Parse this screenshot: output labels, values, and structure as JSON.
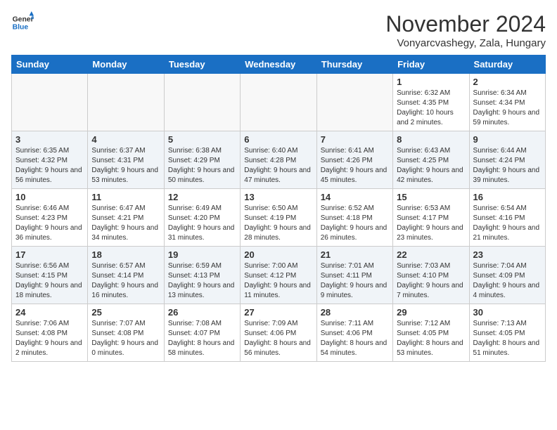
{
  "logo": {
    "line1": "General",
    "line2": "Blue"
  },
  "title": "November 2024",
  "subtitle": "Vonyarcvashegy, Zala, Hungary",
  "days_of_week": [
    "Sunday",
    "Monday",
    "Tuesday",
    "Wednesday",
    "Thursday",
    "Friday",
    "Saturday"
  ],
  "weeks": [
    [
      {
        "day": "",
        "empty": true
      },
      {
        "day": "",
        "empty": true
      },
      {
        "day": "",
        "empty": true
      },
      {
        "day": "",
        "empty": true
      },
      {
        "day": "",
        "empty": true
      },
      {
        "day": "1",
        "sunrise": "6:32 AM",
        "sunset": "4:35 PM",
        "daylight": "10 hours and 2 minutes."
      },
      {
        "day": "2",
        "sunrise": "6:34 AM",
        "sunset": "4:34 PM",
        "daylight": "9 hours and 59 minutes."
      }
    ],
    [
      {
        "day": "3",
        "sunrise": "6:35 AM",
        "sunset": "4:32 PM",
        "daylight": "9 hours and 56 minutes."
      },
      {
        "day": "4",
        "sunrise": "6:37 AM",
        "sunset": "4:31 PM",
        "daylight": "9 hours and 53 minutes."
      },
      {
        "day": "5",
        "sunrise": "6:38 AM",
        "sunset": "4:29 PM",
        "daylight": "9 hours and 50 minutes."
      },
      {
        "day": "6",
        "sunrise": "6:40 AM",
        "sunset": "4:28 PM",
        "daylight": "9 hours and 47 minutes."
      },
      {
        "day": "7",
        "sunrise": "6:41 AM",
        "sunset": "4:26 PM",
        "daylight": "9 hours and 45 minutes."
      },
      {
        "day": "8",
        "sunrise": "6:43 AM",
        "sunset": "4:25 PM",
        "daylight": "9 hours and 42 minutes."
      },
      {
        "day": "9",
        "sunrise": "6:44 AM",
        "sunset": "4:24 PM",
        "daylight": "9 hours and 39 minutes."
      }
    ],
    [
      {
        "day": "10",
        "sunrise": "6:46 AM",
        "sunset": "4:23 PM",
        "daylight": "9 hours and 36 minutes."
      },
      {
        "day": "11",
        "sunrise": "6:47 AM",
        "sunset": "4:21 PM",
        "daylight": "9 hours and 34 minutes."
      },
      {
        "day": "12",
        "sunrise": "6:49 AM",
        "sunset": "4:20 PM",
        "daylight": "9 hours and 31 minutes."
      },
      {
        "day": "13",
        "sunrise": "6:50 AM",
        "sunset": "4:19 PM",
        "daylight": "9 hours and 28 minutes."
      },
      {
        "day": "14",
        "sunrise": "6:52 AM",
        "sunset": "4:18 PM",
        "daylight": "9 hours and 26 minutes."
      },
      {
        "day": "15",
        "sunrise": "6:53 AM",
        "sunset": "4:17 PM",
        "daylight": "9 hours and 23 minutes."
      },
      {
        "day": "16",
        "sunrise": "6:54 AM",
        "sunset": "4:16 PM",
        "daylight": "9 hours and 21 minutes."
      }
    ],
    [
      {
        "day": "17",
        "sunrise": "6:56 AM",
        "sunset": "4:15 PM",
        "daylight": "9 hours and 18 minutes."
      },
      {
        "day": "18",
        "sunrise": "6:57 AM",
        "sunset": "4:14 PM",
        "daylight": "9 hours and 16 minutes."
      },
      {
        "day": "19",
        "sunrise": "6:59 AM",
        "sunset": "4:13 PM",
        "daylight": "9 hours and 13 minutes."
      },
      {
        "day": "20",
        "sunrise": "7:00 AM",
        "sunset": "4:12 PM",
        "daylight": "9 hours and 11 minutes."
      },
      {
        "day": "21",
        "sunrise": "7:01 AM",
        "sunset": "4:11 PM",
        "daylight": "9 hours and 9 minutes."
      },
      {
        "day": "22",
        "sunrise": "7:03 AM",
        "sunset": "4:10 PM",
        "daylight": "9 hours and 7 minutes."
      },
      {
        "day": "23",
        "sunrise": "7:04 AM",
        "sunset": "4:09 PM",
        "daylight": "9 hours and 4 minutes."
      }
    ],
    [
      {
        "day": "24",
        "sunrise": "7:06 AM",
        "sunset": "4:08 PM",
        "daylight": "9 hours and 2 minutes."
      },
      {
        "day": "25",
        "sunrise": "7:07 AM",
        "sunset": "4:08 PM",
        "daylight": "9 hours and 0 minutes."
      },
      {
        "day": "26",
        "sunrise": "7:08 AM",
        "sunset": "4:07 PM",
        "daylight": "8 hours and 58 minutes."
      },
      {
        "day": "27",
        "sunrise": "7:09 AM",
        "sunset": "4:06 PM",
        "daylight": "8 hours and 56 minutes."
      },
      {
        "day": "28",
        "sunrise": "7:11 AM",
        "sunset": "4:06 PM",
        "daylight": "8 hours and 54 minutes."
      },
      {
        "day": "29",
        "sunrise": "7:12 AM",
        "sunset": "4:05 PM",
        "daylight": "8 hours and 53 minutes."
      },
      {
        "day": "30",
        "sunrise": "7:13 AM",
        "sunset": "4:05 PM",
        "daylight": "8 hours and 51 minutes."
      }
    ]
  ]
}
